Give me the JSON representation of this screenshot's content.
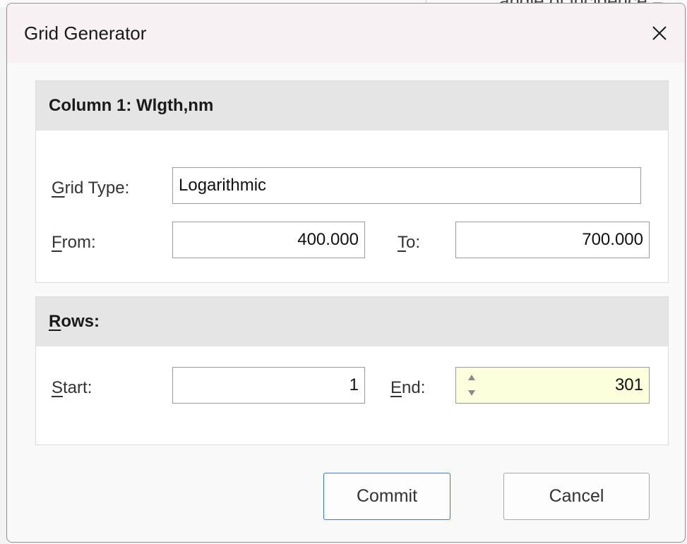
{
  "background": {
    "partial_text": "angle of incidence ="
  },
  "dialog": {
    "title": "Grid Generator"
  },
  "column_group": {
    "header": "Column 1: Wlgth,nm",
    "grid_type": {
      "label_mnemonic": "G",
      "label_rest": "rid Type:",
      "value": "Logarithmic"
    },
    "from": {
      "label_mnemonic": "F",
      "label_rest": "rom:",
      "value": "400.000"
    },
    "to": {
      "label_mnemonic": "T",
      "label_rest": "o:",
      "value": "700.000"
    }
  },
  "rows_group": {
    "header_mnemonic": "R",
    "header_rest": "ows:",
    "start": {
      "label_mnemonic": "S",
      "label_rest": "tart:",
      "value": "1"
    },
    "end": {
      "label_mnemonic": "E",
      "label_rest": "nd:",
      "value": "301"
    }
  },
  "buttons": {
    "commit": "Commit",
    "cancel": "Cancel"
  },
  "colors": {
    "title_bar": "#f8f1f4",
    "group_header": "#e5e5e5",
    "active_field": "#fcffdc",
    "primary_border": "#2f7fcf"
  },
  "icons": {
    "close": "close-icon",
    "spinner": "spinner-arrows-icon"
  }
}
